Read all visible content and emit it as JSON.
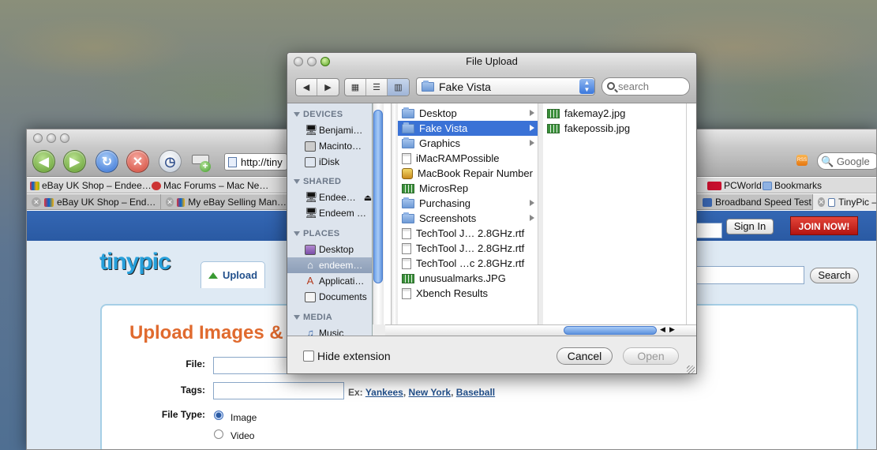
{
  "browser": {
    "address": "http://tiny",
    "search_placeholder": "Google",
    "rss_label": "RSS",
    "bookmarks": [
      "eBay UK Shop – Endee…",
      "Mac Forums – Mac Ne…",
      "PCWorld",
      "Bookmarks"
    ],
    "tabs": [
      "eBay UK Shop – End…",
      "My eBay Selling Man…",
      "Broadband Speed Test",
      "TinyPic –"
    ]
  },
  "page": {
    "logo": "tinypic",
    "upload_tab": "Upload",
    "sign_in": "Sign In",
    "join": "JOIN NOW!",
    "search_button": "Search",
    "heading": "Upload Images &",
    "file_label": "File:",
    "tags_label": "Tags:",
    "tags_hint_prefix": "Ex:",
    "tag_examples": [
      "Yankees",
      "New York",
      "Baseball"
    ],
    "file_type_label": "File Type:",
    "file_types": [
      "Image",
      "Video"
    ]
  },
  "dialog": {
    "title": "File Upload",
    "current_folder": "Fake Vista",
    "search_placeholder": "search",
    "sidebar": {
      "devices_header": "DEVICES",
      "devices": [
        "Benjami…",
        "Macinto…",
        "iDisk"
      ],
      "shared_header": "SHARED",
      "shared": [
        "Endee…",
        "Endeem …"
      ],
      "places_header": "PLACES",
      "places": [
        "Desktop",
        "endeem…",
        "Applicati…",
        "Documents"
      ],
      "media_header": "MEDIA",
      "media": [
        "Music"
      ]
    },
    "column1": [
      {
        "name": "Desktop",
        "kind": "folder",
        "arrow": true
      },
      {
        "name": "Fake Vista",
        "kind": "folder",
        "arrow": true,
        "selected": true
      },
      {
        "name": "Graphics",
        "kind": "folder",
        "arrow": true
      },
      {
        "name": "iMacRAMPossible",
        "kind": "doc"
      },
      {
        "name": "MacBook Repair Number",
        "kind": "app"
      },
      {
        "name": "MicrosRep",
        "kind": "jpg"
      },
      {
        "name": "Purchasing",
        "kind": "folder",
        "arrow": true
      },
      {
        "name": "Screenshots",
        "kind": "folder",
        "arrow": true
      },
      {
        "name": "TechTool J… 2.8GHz.rtf",
        "kind": "doc"
      },
      {
        "name": "TechTool J… 2.8GHz.rtf",
        "kind": "doc"
      },
      {
        "name": "TechTool …c 2.8GHz.rtf",
        "kind": "doc"
      },
      {
        "name": "unusualmarks.JPG",
        "kind": "jpg"
      },
      {
        "name": "Xbench Results",
        "kind": "doc"
      }
    ],
    "column2": [
      {
        "name": "fakemay2.jpg",
        "kind": "jpg"
      },
      {
        "name": "fakepossib.jpg",
        "kind": "jpg"
      }
    ],
    "hide_extension": "Hide extension",
    "cancel": "Cancel",
    "open": "Open"
  }
}
